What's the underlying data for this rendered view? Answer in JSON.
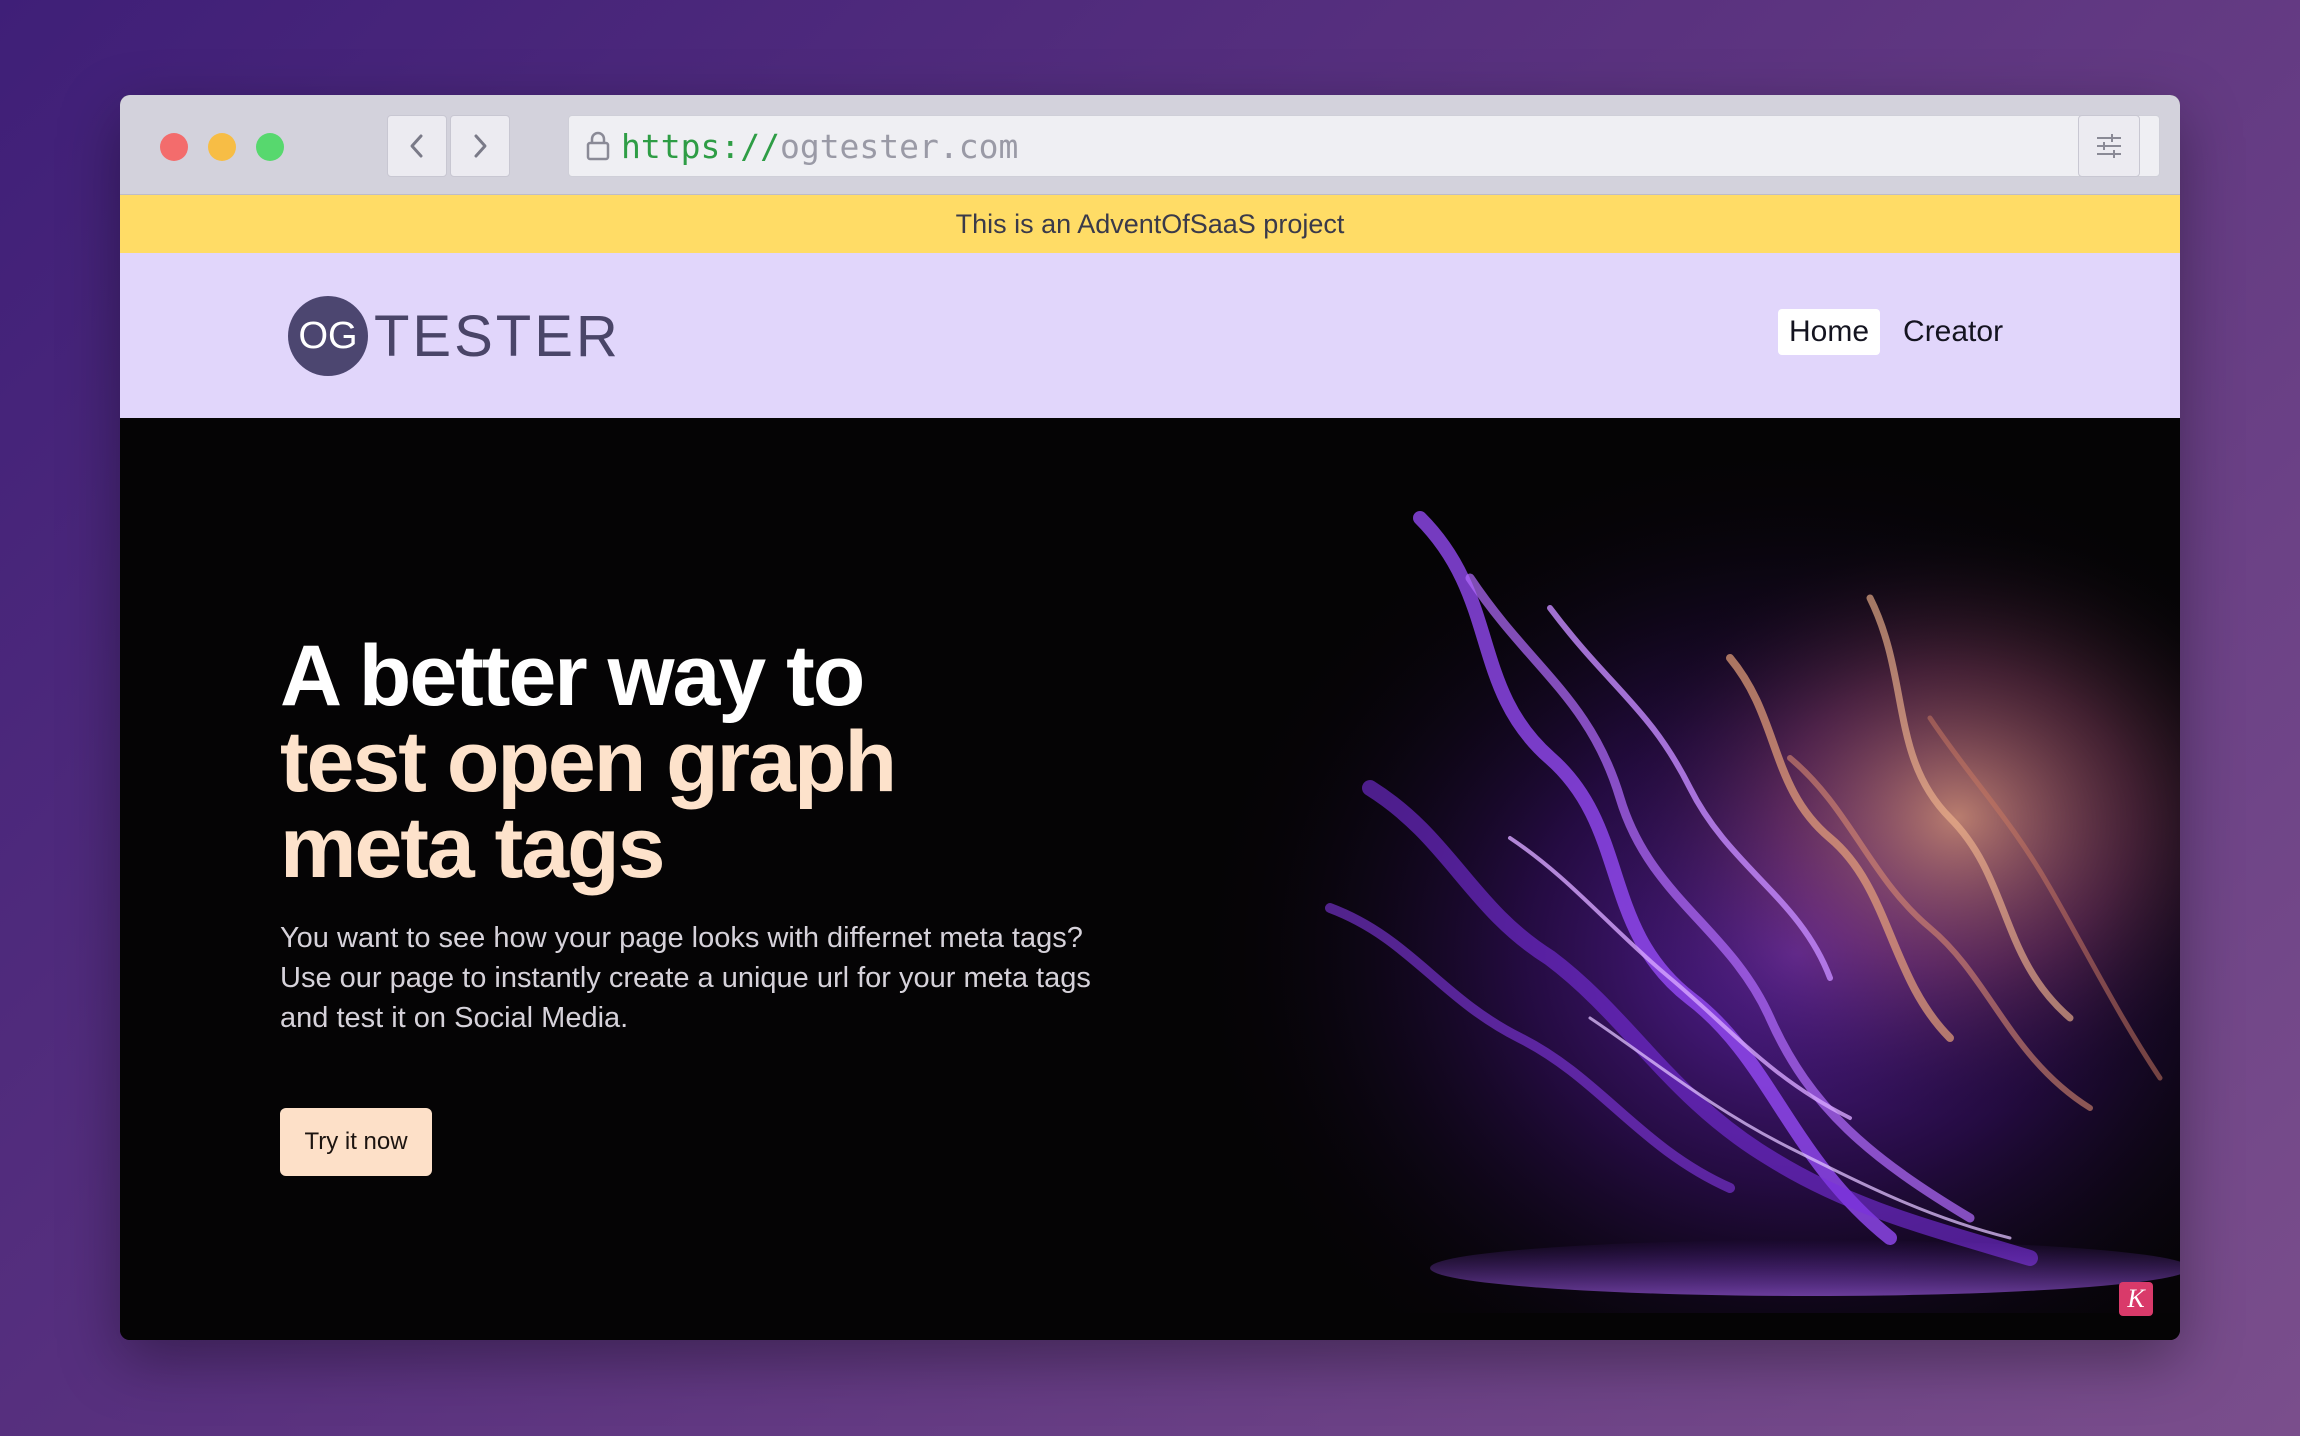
{
  "browser": {
    "url_protocol": "https://",
    "url_host": "ogtester.com"
  },
  "banner": {
    "text": "This is an AdventOfSaaS project"
  },
  "header": {
    "logo_mark": "OG",
    "logo_text": "TESTER",
    "nav": [
      {
        "label": "Home",
        "active": true
      },
      {
        "label": "Creator",
        "active": false
      }
    ]
  },
  "hero": {
    "title_line1": "A better way to",
    "title_line2": "test open graph",
    "title_line3": "meta tags",
    "description_line1": "You want to see how your page looks with differnet meta tags?",
    "description_line2": "Use our page to instantly create a unique url for your meta tags",
    "description_line3": "and test it on Social Media.",
    "cta_label": "Try it now",
    "badge": "K"
  },
  "icons": {
    "lock": "lock-icon",
    "back": "chevron-left-icon",
    "forward": "chevron-right-icon",
    "settings": "sliders-icon"
  },
  "colors": {
    "banner": "#ffdc66",
    "header_bg": "#e1d6fb",
    "accent_peach": "#fde0c8",
    "hero_bg": "#050405",
    "logo_circle": "#4c4670"
  }
}
